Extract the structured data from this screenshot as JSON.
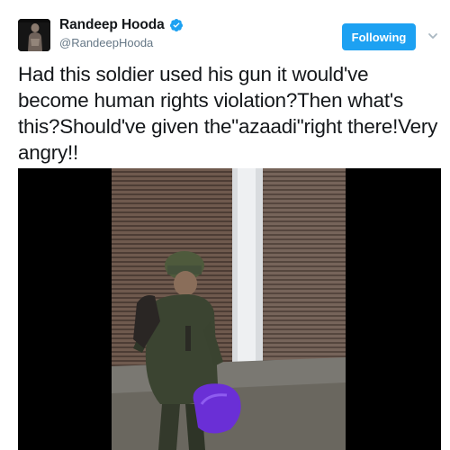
{
  "user": {
    "display_name": "Randeep Hooda",
    "handle": "@RandeepHooda",
    "verified_icon": "verified-badge-icon",
    "avatar": "profile-photo"
  },
  "actions": {
    "follow_label": "Following",
    "menu_icon": "chevron-down-icon"
  },
  "tweet": {
    "text": "Had this soldier used his gun it would've become human rights violation?Then what's this?Should've given the\"azaadi\"right there!Very angry!!"
  },
  "media": {
    "type": "video-thumbnail"
  },
  "colors": {
    "accent": "#1da1f2",
    "text": "#14171a",
    "muted": "#657786"
  }
}
